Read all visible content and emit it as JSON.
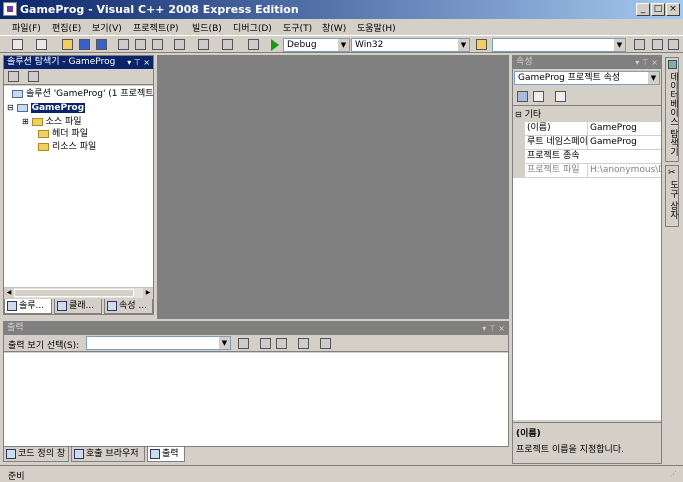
{
  "window": {
    "title": "GameProg - Visual C++ 2008 Express Edition",
    "min": "_",
    "max": "□",
    "close": "×"
  },
  "menu": [
    "파일(F)",
    "편집(E)",
    "보기(V)",
    "프로젝트(P)",
    "빌드(B)",
    "디버그(D)",
    "도구(T)",
    "창(W)",
    "도움말(H)"
  ],
  "toolbar": {
    "config": "Debug",
    "platform": "Win32",
    "find": ""
  },
  "solution_explorer": {
    "title": "솔루션 탐색기 - GameProg",
    "solution": "솔루션 'GameProg' (1 프로젝트)",
    "project": "GameProg",
    "folders": [
      "소스 파일",
      "헤더 파일",
      "리소스 파일"
    ],
    "tabs": [
      "솔루...",
      "클래...",
      "속성 ..."
    ]
  },
  "properties": {
    "title": "속성",
    "object": "GameProg 프로젝트 속성",
    "category": "기타",
    "rows": [
      {
        "name": "(이름)",
        "value": "GameProg"
      },
      {
        "name": "루트 네임스페이",
        "value": "GameProg"
      },
      {
        "name": "프로젝트 종속",
        "value": ""
      },
      {
        "name": "프로젝트 파일",
        "value": "H:\\anonymous\\D"
      }
    ],
    "desc_title": "(이름)",
    "desc_text": "프로젝트 이름을 지정합니다."
  },
  "side_tabs": [
    "데이터베이스 탐색기",
    "도구 상자"
  ],
  "output": {
    "title": "출력",
    "label": "출력 보기 선택(S):",
    "tabs": [
      "코드 정의 창",
      "호출 브라우저",
      "출력"
    ]
  },
  "status": "준비"
}
